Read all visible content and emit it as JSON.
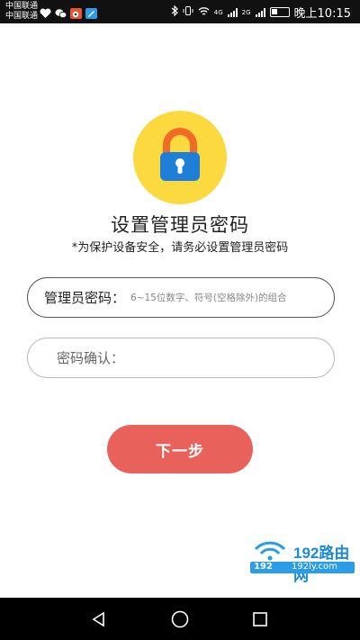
{
  "status_bar": {
    "carrier_1": "中国联通",
    "carrier_2": "中国联通",
    "network_1": "4G",
    "network_2": "2G",
    "time": "晚上10:15",
    "notification_icons": [
      "health-icon",
      "wechat-icon",
      "weibo-icon",
      "app-icon"
    ]
  },
  "header": {
    "title": "设置管理员密码",
    "subtitle": "*为保护设备安全，请务必设置管理员密码",
    "lock_icon": "lock-icon"
  },
  "form": {
    "password_label": "管理员密码：",
    "password_placeholder": "6~15位数字、符号(空格除外)的组合",
    "password_value": "",
    "confirm_label": "密码确认：",
    "confirm_placeholder": "",
    "confirm_value": ""
  },
  "actions": {
    "next_label": "下一步"
  },
  "watermark": {
    "brand": "192路由网",
    "tag": "192",
    "domain": "192ly.com"
  },
  "colors": {
    "accent_button": "#e8625b",
    "lock_circle": "#fcd93f",
    "lock_body": "#1e7fd9",
    "lock_shackle": "#f06a28"
  }
}
